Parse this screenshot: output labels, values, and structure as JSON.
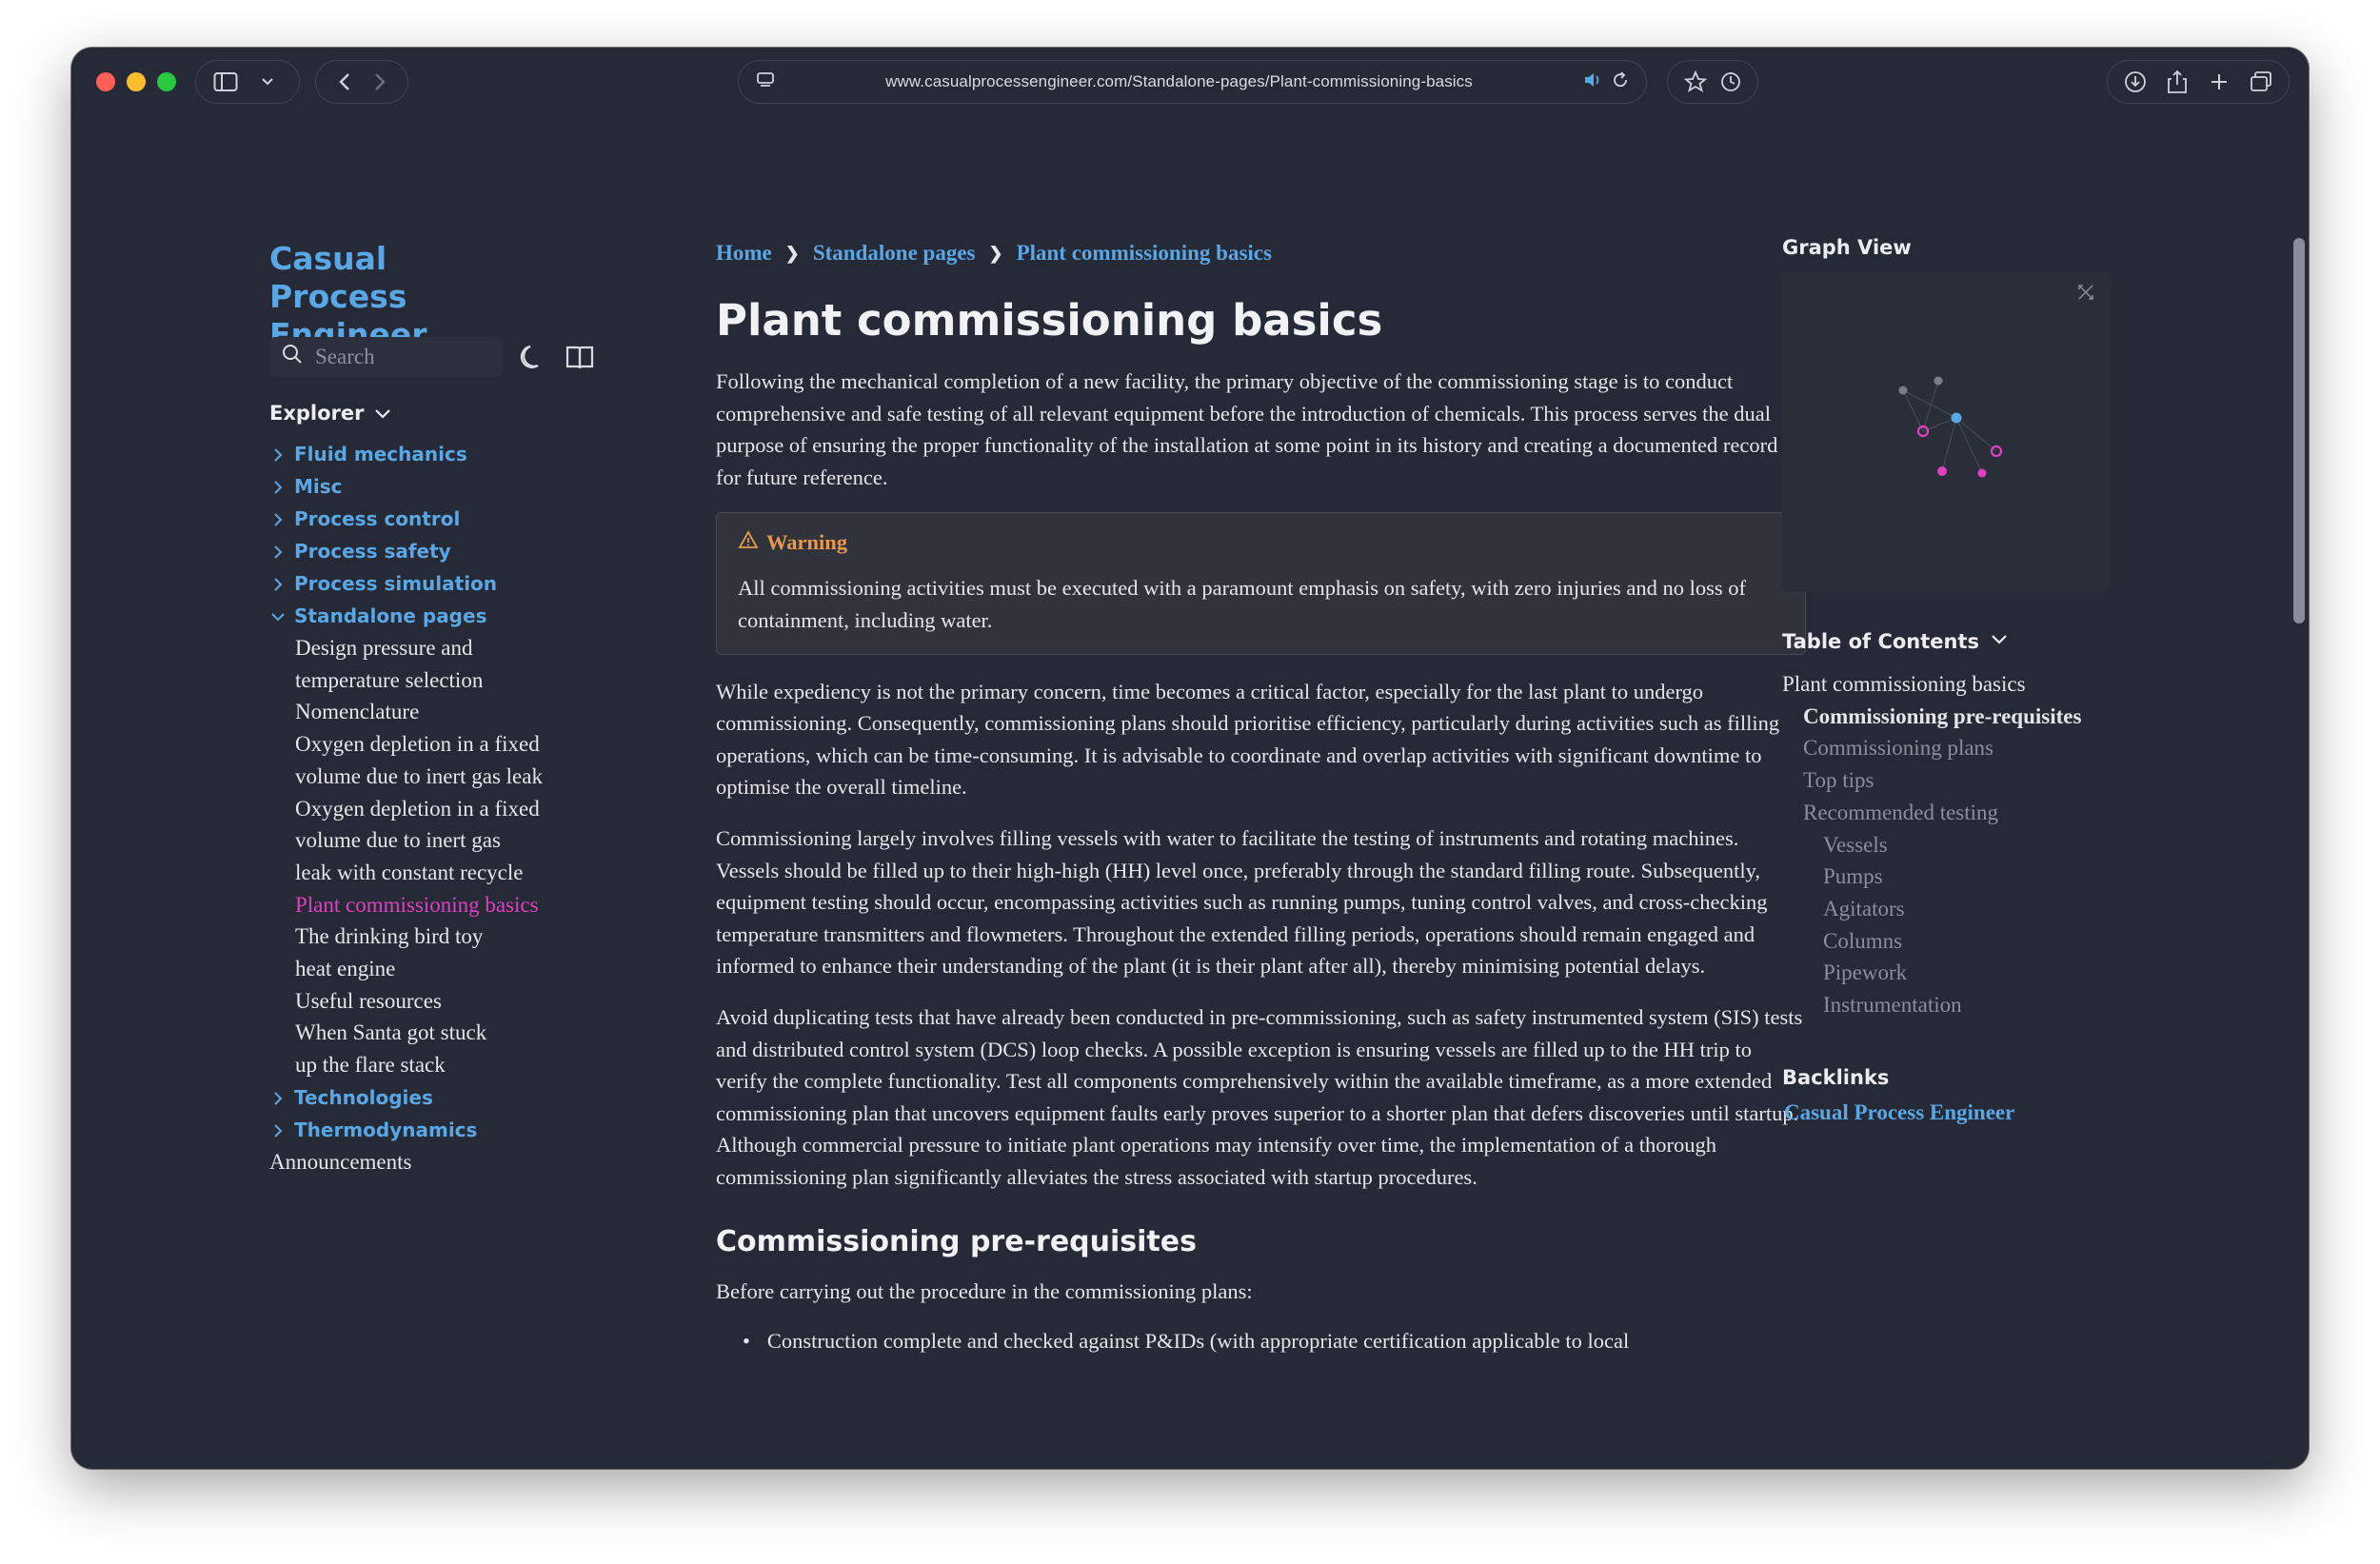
{
  "browser": {
    "url": "www.casualprocessengineer.com/Standalone-pages/Plant-commissioning-basics"
  },
  "site": {
    "title": "Casual Process Engineer",
    "search_placeholder": "Search"
  },
  "explorer": {
    "heading": "Explorer",
    "folders_top": [
      "Fluid mechanics",
      "Misc",
      "Process control",
      "Process safety",
      "Process simulation"
    ],
    "open_folder": "Standalone pages",
    "open_folder_items": [
      "Design pressure and",
      "temperature selection",
      "Nomenclature",
      "Oxygen depletion in a fixed",
      "volume due to inert gas leak",
      "Oxygen depletion in a fixed",
      "volume due to inert gas",
      "leak with constant recycle",
      "Plant commissioning basics",
      "The drinking bird toy",
      "heat engine",
      "Useful resources",
      "When Santa got stuck",
      "up the flare stack"
    ],
    "folders_bottom": [
      "Technologies",
      "Thermodynamics"
    ],
    "extra": "Announcements"
  },
  "breadcrumb": [
    "Home",
    "Standalone pages",
    "Plant commissioning basics"
  ],
  "article": {
    "title": "Plant commissioning basics",
    "intro": "Following the mechanical completion of a new facility, the primary objective of the commissioning stage is to conduct comprehensive and safe testing of all relevant equipment before the introduction of chemicals. This process serves the dual purpose of ensuring the proper functionality of the installation at some point in its history and creating a documented record for future reference.",
    "warning_title": "Warning",
    "warning_body": "All commissioning activities must be executed with a paramount emphasis on safety, with zero injuries and no loss of containment, including water.",
    "p2": "While expediency is not the primary concern, time becomes a critical factor, especially for the last plant to undergo commissioning. Consequently, commissioning plans should prioritise efficiency, particularly during activities such as filling operations, which can be time-consuming. It is advisable to coordinate and overlap activities with significant downtime to optimise the overall timeline.",
    "p3": "Commissioning largely involves filling vessels with water to facilitate the testing of instruments and rotating machines. Vessels should be filled up to their high-high (HH) level once, preferably through the standard filling route. Subsequently, equipment testing should occur, encompassing activities such as running pumps, tuning control valves, and cross-checking temperature transmitters and flowmeters. Throughout the extended filling periods, operations should remain engaged and informed to enhance their understanding of the plant (it is their plant after all), thereby minimising potential delays.",
    "p4": "Avoid duplicating tests that have already been conducted in pre-commissioning, such as safety instrumented system (SIS) tests and distributed control system (DCS) loop checks. A possible exception is ensuring vessels are filled up to the HH trip to verify the complete functionality. Test all components comprehensively within the available timeframe, as a more extended commissioning plan that uncovers equipment faults early proves superior to a shorter plan that defers discoveries until startup. Although commercial pressure to initiate plant operations may intensify over time, the implementation of a thorough commissioning plan significantly alleviates the stress associated with startup procedures.",
    "h2": "Commissioning pre-requisites",
    "p5": "Before carrying out the procedure in the commissioning plans:",
    "bullet1": "Construction complete and checked against P&IDs (with appropriate certification applicable to local"
  },
  "graph": {
    "heading": "Graph View"
  },
  "toc": {
    "heading": "Table of Contents",
    "items": [
      "Plant commissioning basics",
      "Commissioning pre-requisites",
      "Commissioning plans",
      "Top tips",
      "Recommended testing",
      "Vessels",
      "Pumps",
      "Agitators",
      "Columns",
      "Pipework",
      "Instrumentation"
    ]
  },
  "backlinks": {
    "heading": "Backlinks",
    "items": [
      "Casual Process Engineer"
    ]
  },
  "colors": {
    "accent": "#5aa7e6",
    "active": "#e040c2",
    "background": "#262a36",
    "warning": "#e89a4a"
  }
}
